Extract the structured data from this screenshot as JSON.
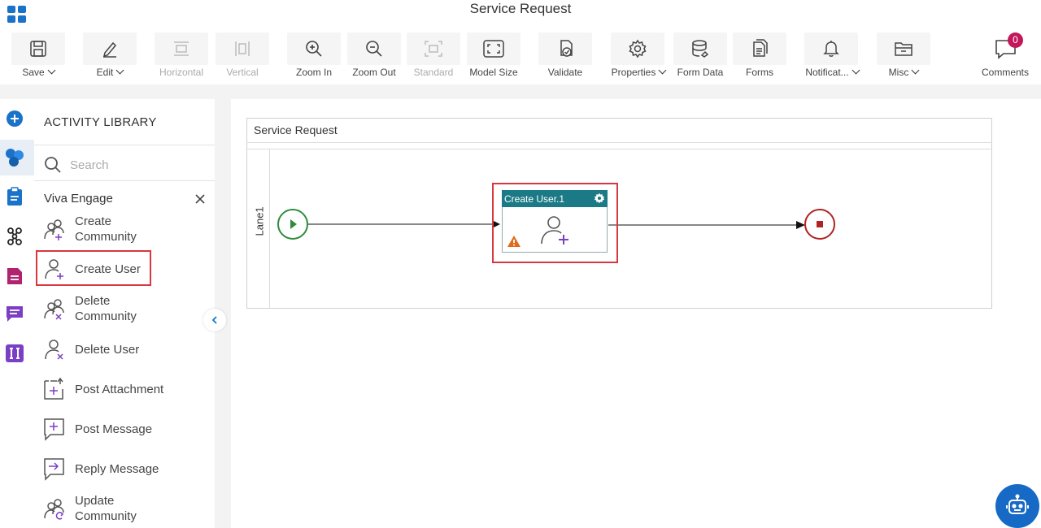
{
  "app": {
    "title": "Service Request"
  },
  "toolbar": {
    "save": "Save",
    "edit": "Edit",
    "horizontal": "Horizontal",
    "vertical": "Vertical",
    "zoom_in": "Zoom In",
    "zoom_out": "Zoom Out",
    "standard": "Standard",
    "model_size": "Model Size",
    "validate": "Validate",
    "properties": "Properties",
    "form_data": "Form Data",
    "forms": "Forms",
    "notifications": "Notificat...",
    "misc": "Misc",
    "comments": "Comments",
    "comments_count": "0"
  },
  "library": {
    "title": "ACTIVITY LIBRARY",
    "search_placeholder": "Search",
    "category": "Viva Engage",
    "items": [
      {
        "label": "Create Community",
        "icon": "create-community-icon"
      },
      {
        "label": "Create User",
        "icon": "create-user-icon",
        "selected": true
      },
      {
        "label": "Delete Community",
        "icon": "delete-community-icon"
      },
      {
        "label": "Delete User",
        "icon": "delete-user-icon"
      },
      {
        "label": "Post Attachment",
        "icon": "post-attachment-icon"
      },
      {
        "label": "Post Message",
        "icon": "post-message-icon"
      },
      {
        "label": "Reply Message",
        "icon": "reply-message-icon"
      },
      {
        "label": "Update Community",
        "icon": "update-community-icon"
      }
    ]
  },
  "canvas": {
    "pool_title": "Service Request",
    "lane_label": "Lane1",
    "node_title": "Create User.1"
  },
  "colors": {
    "accent": "#1b7a86",
    "selection": "#d9363e",
    "start": "#2e8b3e",
    "end": "#b22222",
    "icon_purple": "#7b3fc4",
    "badge": "#c2185b"
  }
}
